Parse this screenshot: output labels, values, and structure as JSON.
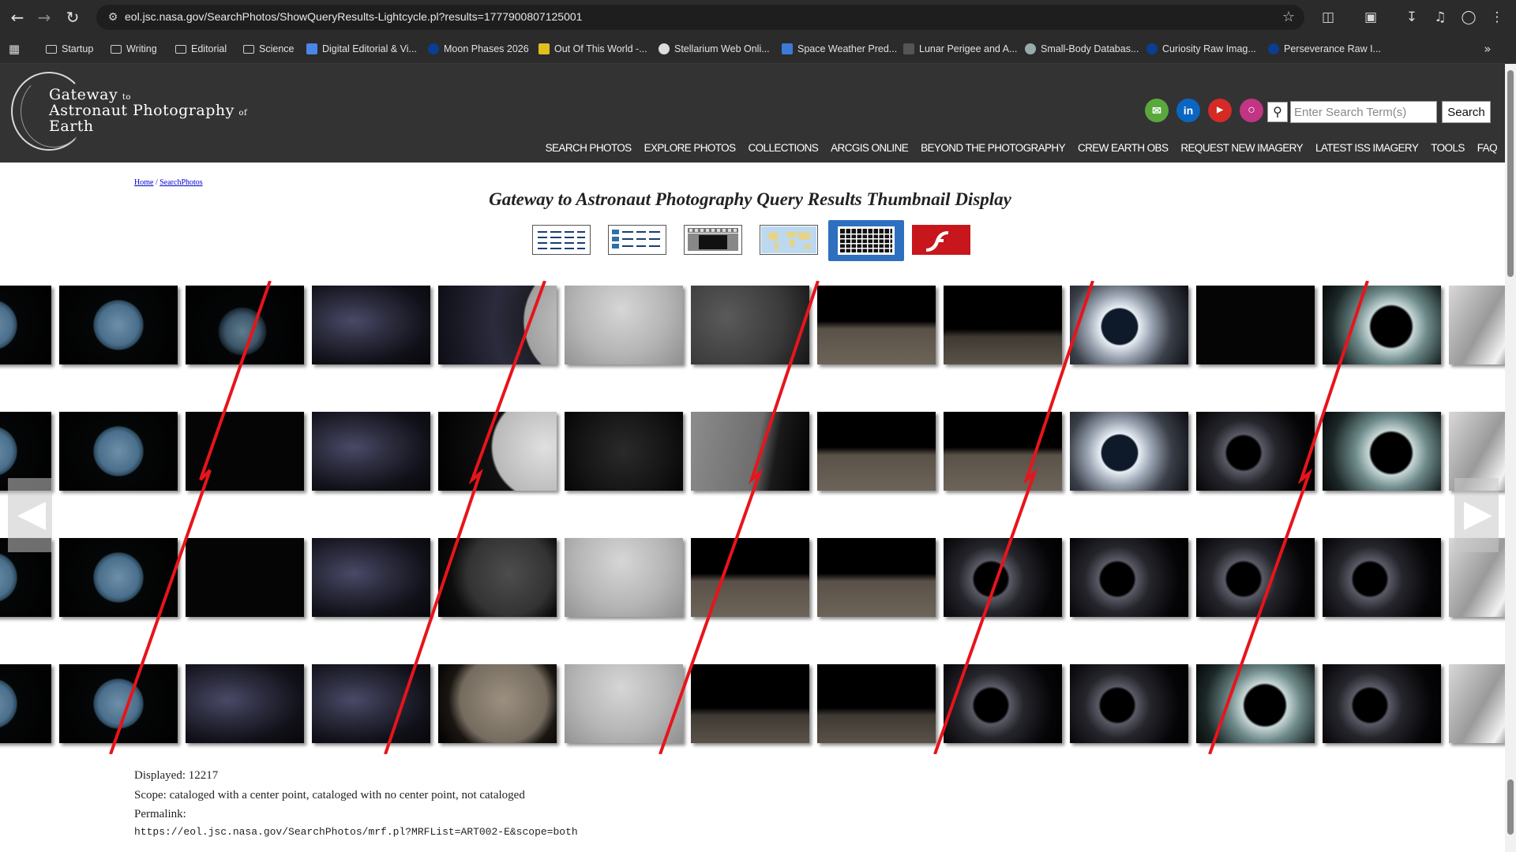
{
  "browser": {
    "url": "eol.jsc.nasa.gov/SearchPhotos/ShowQueryResults-Lightcycle.pl?results=1777900807125001",
    "bookmarks": [
      {
        "label": "Startup",
        "icon": "folder-icon"
      },
      {
        "label": "Writing",
        "icon": "folder-icon"
      },
      {
        "label": "Editorial",
        "icon": "folder-icon"
      },
      {
        "label": "Science",
        "icon": "folder-icon"
      },
      {
        "label": "Digital Editorial & Vi...",
        "icon": "doc-icon"
      },
      {
        "label": "Moon Phases 2026",
        "icon": "nasa-icon"
      },
      {
        "label": "Out Of This World -...",
        "icon": "yellow-icon"
      },
      {
        "label": "Stellarium Web Onli...",
        "icon": "stellarium-icon"
      },
      {
        "label": "Space Weather Pred...",
        "icon": "swpc-icon"
      },
      {
        "label": "Lunar Perigee and A...",
        "icon": "fourmilab-icon"
      },
      {
        "label": "Small-Body Databas...",
        "icon": "globe-icon"
      },
      {
        "label": "Curiosity Raw Imag...",
        "icon": "nasa-icon"
      },
      {
        "label": "Perseverance Raw I...",
        "icon": "nasa-icon"
      }
    ]
  },
  "header": {
    "logo": {
      "line1": "Gateway",
      "line1_small": "to",
      "line2": "Astronaut Photography",
      "line2_small": "of",
      "line3": "Earth"
    },
    "social": [
      "email-icon",
      "linkedin-icon",
      "youtube-icon",
      "instagram-icon"
    ],
    "search_placeholder": "Enter Search Term(s)",
    "search_button": "Search",
    "nav": [
      "SEARCH PHOTOS",
      "EXPLORE PHOTOS",
      "COLLECTIONS",
      "ARCGIS ONLINE",
      "BEYOND THE PHOTOGRAPHY",
      "CREW EARTH OBS",
      "REQUEST NEW IMAGERY",
      "LATEST ISS IMAGERY",
      "TOOLS",
      "FAQ"
    ]
  },
  "breadcrumb": {
    "home": "Home",
    "separator": " / ",
    "current": "SearchPhotos"
  },
  "title": "Gateway to Astronaut Photography Query Results Thumbnail Display",
  "view_modes": [
    {
      "name": "list-view",
      "selected": false
    },
    {
      "name": "detail-list-view",
      "selected": false
    },
    {
      "name": "lightbox-view",
      "selected": false
    },
    {
      "name": "map-view",
      "selected": false
    },
    {
      "name": "thumbnail-grid-view",
      "selected": true
    },
    {
      "name": "flash-view",
      "selected": false
    }
  ],
  "thumbnail_grid": {
    "rows": [
      [
        "earth",
        "earth",
        "earth-dark",
        "stars",
        "moon-edge",
        "moon",
        "moon-dark",
        "earthrise",
        "earthrise-small",
        "eclipse",
        "dark",
        "eclipse-teal",
        "spacecraft"
      ],
      [
        "earth",
        "earth",
        "dark",
        "stars",
        "moon-half",
        "dark-moon",
        "moon-partial",
        "earthrise",
        "earthrise",
        "eclipse",
        "eclipse-dim",
        "eclipse-teal",
        "spacecraft"
      ],
      [
        "earth",
        "earth",
        "dark",
        "stars",
        "moon-dim",
        "moon",
        "earthrise",
        "earthrise",
        "eclipse-dim",
        "eclipse-dim",
        "eclipse-dim",
        "eclipse-dim",
        "spacecraft"
      ],
      [
        "earth",
        "earth",
        "stars",
        "stars",
        "moon-brown",
        "moon",
        "earthrise-small",
        "earthrise-small",
        "eclipse-dim",
        "eclipse-dim",
        "eclipse-teal",
        "eclipse-dim",
        "spacecraft"
      ]
    ],
    "annotation_color": "#e8141b"
  },
  "results": {
    "displayed": "Displayed: 12217",
    "scope": "Scope: cataloged with a center point, cataloged with no center point, not cataloged",
    "permalink_label": "Permalink:",
    "permalink_url": "https://eol.jsc.nasa.gov/SearchPhotos/mrf.pl?MRFList=ART002-E&scope=both"
  }
}
